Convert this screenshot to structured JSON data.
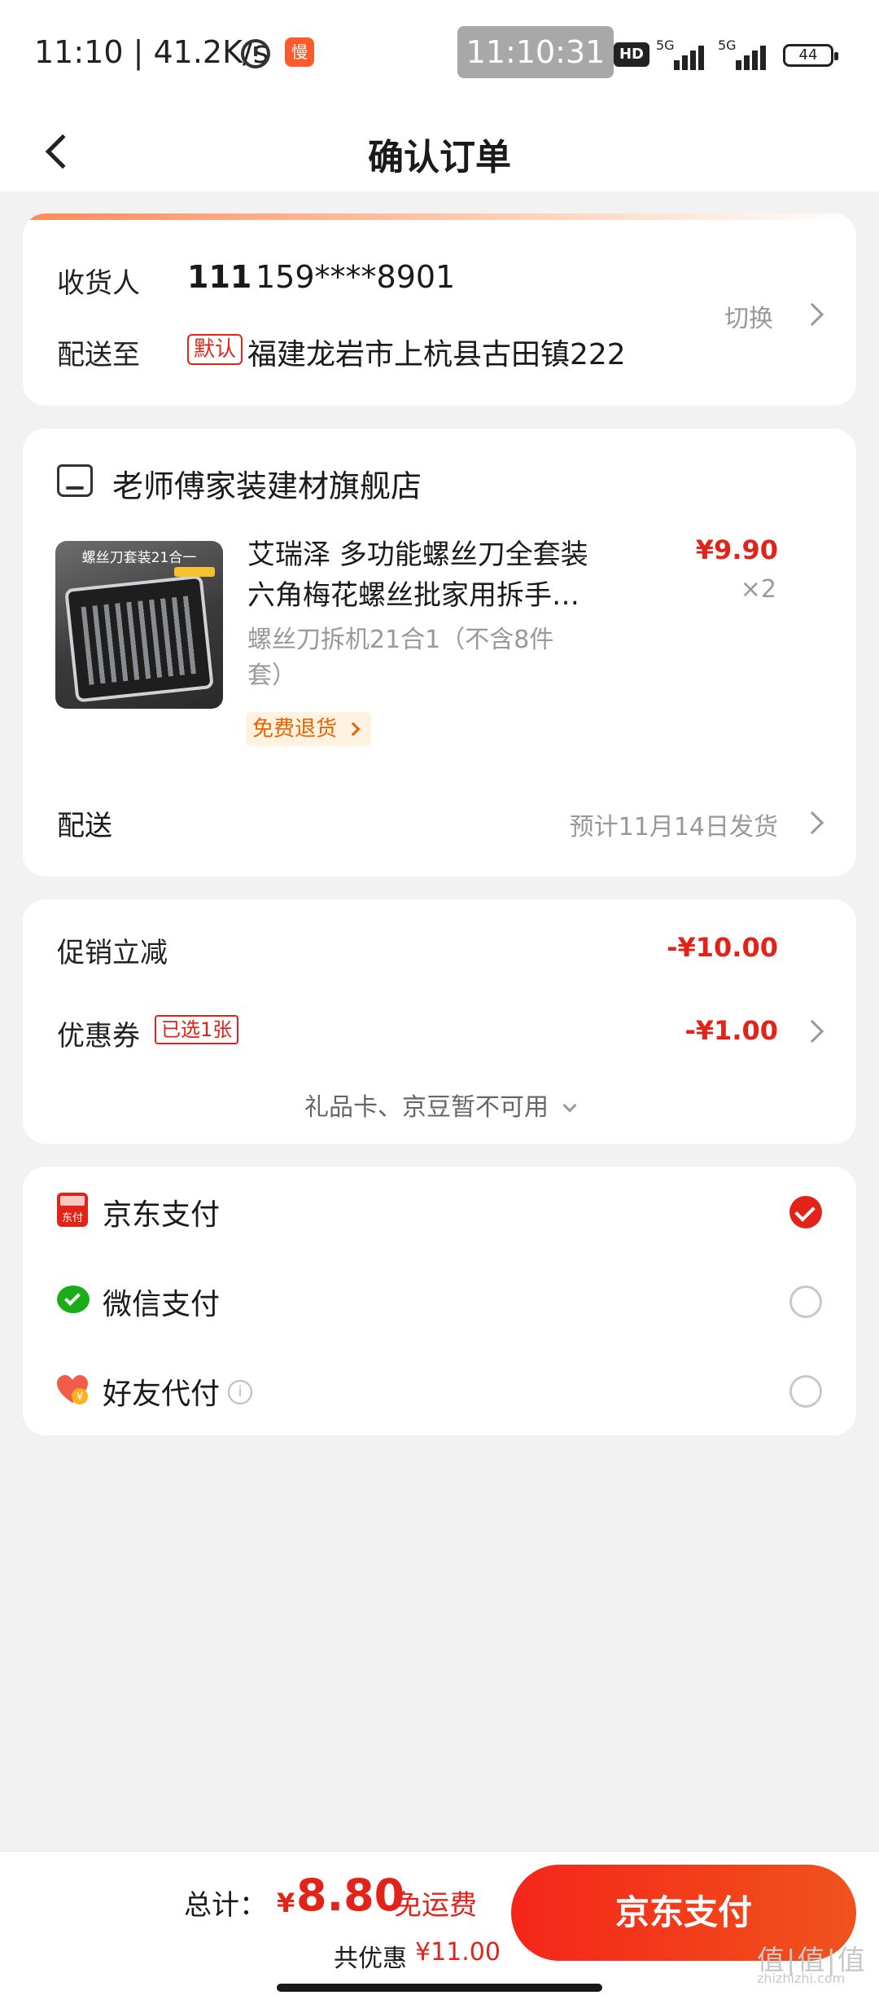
{
  "status_bar": {
    "time": "11:10 | 41.2K/s",
    "app_icon_text": "慢",
    "clock": "11:10:31",
    "hd": "HD",
    "net1": "5G",
    "net2": "5G",
    "battery": "44"
  },
  "header": {
    "title": "确认订单"
  },
  "address": {
    "recipient_label": "收货人",
    "name": "111",
    "phone": "159****8901",
    "ship_to_label": "配送至",
    "default_tag": "默认",
    "address": "福建龙岩市上杭县古田镇222",
    "switch_label": "切换"
  },
  "store": {
    "name": "老师傅家装建材旗舰店",
    "product": {
      "thumb_title": "螺丝刀套装21合一",
      "title_line1": "艾瑞泽 多功能螺丝刀全套装",
      "title_line2": "六角梅花螺丝批家用拆手…",
      "price": "¥9.90",
      "quantity": "×2",
      "spec_line1": "螺丝刀拆机21合1（不含8件",
      "spec_line2": "套）",
      "free_return": "免费退货"
    },
    "shipping_label": "配送",
    "shipping_value": "预计11月14日发货"
  },
  "promo": {
    "promo_label": "促销立减",
    "promo_value": "-¥10.00",
    "coupon_label": "优惠券",
    "coupon_tag": "已选1张",
    "coupon_value": "-¥1.00",
    "gift_line": "礼品卡、京豆暂不可用"
  },
  "payment": {
    "methods": [
      {
        "label": "京东支付",
        "icon_text": "东付",
        "selected": true
      },
      {
        "label": "微信支付",
        "selected": false
      },
      {
        "label": "好友代付",
        "selected": false
      }
    ],
    "info_icon": "i"
  },
  "footer": {
    "total_label": "总计：",
    "currency": "¥",
    "total_amount": "8.80",
    "free_shipping": "免运费",
    "saved_label": "共优惠",
    "saved_amount": "¥11.00",
    "pay_button": "京东支付",
    "watermark": "值|值|值",
    "watermark_url": "zhizhizhi.com"
  },
  "colors": {
    "accent_red": "#e2231a",
    "button_gradient_start": "#f5251a",
    "button_gradient_end": "#f0531c",
    "wechat_green": "#1aad19"
  },
  "icons": [
    "chevron-left-icon",
    "store-icon",
    "chevron-right-icon",
    "chevron-down-icon",
    "checkmark-icon",
    "info-icon",
    "jd-pay-icon",
    "wechat-icon",
    "friend-pay-icon"
  ]
}
